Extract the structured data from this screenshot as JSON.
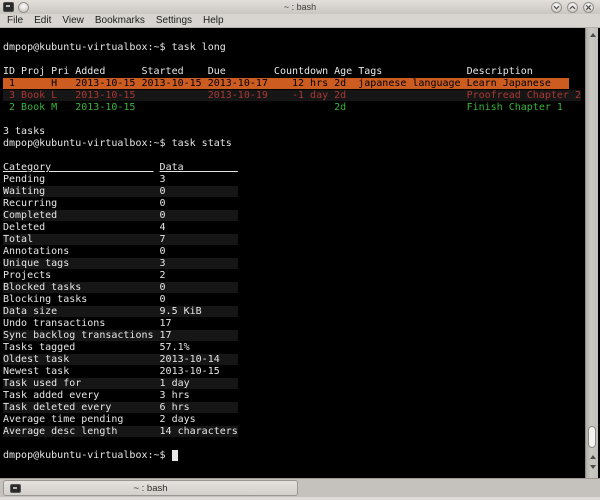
{
  "window": {
    "title": "~ : bash",
    "controls": {
      "minimize": "minimize",
      "maximize": "maximize",
      "close": "close"
    }
  },
  "menu": {
    "items": [
      "File",
      "Edit",
      "View",
      "Bookmarks",
      "Settings",
      "Help"
    ]
  },
  "terminal": {
    "prompt": "dmpop@kubuntu-virtualbox:~$",
    "command_1": "task long",
    "command_2": "task stats",
    "task_table": {
      "columns": [
        {
          "label": "ID",
          "start": 0,
          "width": 2,
          "align": "right"
        },
        {
          "label": "Proj",
          "start": 3,
          "width": 4,
          "align": "left"
        },
        {
          "label": "Pri",
          "start": 8,
          "width": 3,
          "align": "left"
        },
        {
          "label": "Added",
          "start": 12,
          "width": 10,
          "align": "left"
        },
        {
          "label": "Started",
          "start": 23,
          "width": 10,
          "align": "left"
        },
        {
          "label": "Due",
          "start": 34,
          "width": 10,
          "align": "left"
        },
        {
          "label": "Countdown",
          "start": 45,
          "width": 9,
          "align": "right"
        },
        {
          "label": "Age",
          "start": 55,
          "width": 3,
          "align": "left"
        },
        {
          "label": "Tags",
          "start": 59,
          "width": 17,
          "align": "left"
        },
        {
          "label": "Description",
          "start": 77,
          "width": 19,
          "align": "left"
        }
      ],
      "rows": [
        {
          "style": "active",
          "cells": [
            "1",
            "",
            "H",
            "2013-10-15",
            "2013-10-15",
            "2013-10-17",
            "12 hrs",
            "2d",
            "japanese language",
            "Learn Japanese"
          ]
        },
        {
          "style": "overdue",
          "cells": [
            "3",
            "Book",
            "L",
            "2013-10-15",
            "",
            "2013-10-19",
            "-1 day",
            "2d",
            "",
            "Proofread Chapter 2"
          ]
        },
        {
          "style": "normal",
          "cells": [
            "2",
            "Book",
            "M",
            "2013-10-15",
            "",
            "",
            "",
            "2d",
            "",
            "Finish Chapter 1"
          ]
        }
      ],
      "footer": "3 tasks"
    },
    "stats_table": {
      "headers": [
        "Category",
        "Data"
      ],
      "category_col_width": 25,
      "data_col_width": 13,
      "rows": [
        [
          "Pending",
          "3"
        ],
        [
          "Waiting",
          "0"
        ],
        [
          "Recurring",
          "0"
        ],
        [
          "Completed",
          "0"
        ],
        [
          "Deleted",
          "4"
        ],
        [
          "Total",
          "7"
        ],
        [
          "Annotations",
          "0"
        ],
        [
          "Unique tags",
          "3"
        ],
        [
          "Projects",
          "2"
        ],
        [
          "Blocked tasks",
          "0"
        ],
        [
          "Blocking tasks",
          "0"
        ],
        [
          "Data size",
          "9.5 KiB"
        ],
        [
          "Undo transactions",
          "17"
        ],
        [
          "Sync backlog transactions",
          "17"
        ],
        [
          "Tasks tagged",
          "57.1%"
        ],
        [
          "Oldest task",
          "2013-10-14"
        ],
        [
          "Newest task",
          "2013-10-15"
        ],
        [
          "Task used for",
          "1 day"
        ],
        [
          "Task added every",
          "3 hrs"
        ],
        [
          "Task deleted every",
          "6 hrs"
        ],
        [
          "Average time pending",
          "2 days"
        ],
        [
          "Average desc length",
          "14 characters"
        ]
      ]
    },
    "colors": {
      "background": "#000000",
      "foreground": "#e6e6e6",
      "active_row_bg": "#cc5c20",
      "active_row_fg": "#000000",
      "overdue_fg": "#aa3832",
      "green_fg": "#3ab33a",
      "stripe_bg": "#161616"
    }
  },
  "tab_bar": {
    "tab_label": "~ : bash"
  }
}
